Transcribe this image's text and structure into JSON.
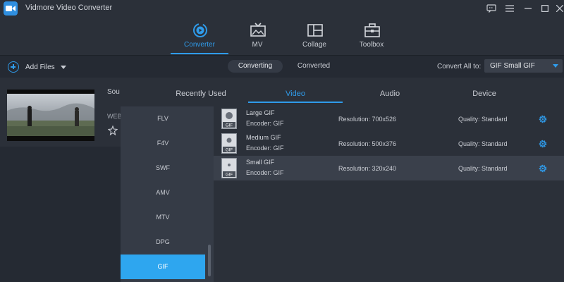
{
  "app": {
    "title": "Vidmore Video Converter"
  },
  "nav": [
    {
      "label": "Converter",
      "icon": "converter-icon",
      "active": true
    },
    {
      "label": "MV",
      "icon": "mv-icon"
    },
    {
      "label": "Collage",
      "icon": "collage-icon"
    },
    {
      "label": "Toolbox",
      "icon": "toolbox-icon"
    }
  ],
  "toolbar": {
    "add_files": "Add Files",
    "tabs": [
      "Converting",
      "Converted"
    ],
    "convert_all_label": "Convert All to:",
    "convert_all_value": "GIF Small GIF"
  },
  "file": {
    "source_prefix": "Sou",
    "format_prefix": "WEB"
  },
  "panel": {
    "tabs": [
      "Recently Used",
      "Video",
      "Audio",
      "Device"
    ],
    "active_tab": "Video",
    "formats": [
      "FLV",
      "F4V",
      "SWF",
      "AMV",
      "MTV",
      "DPG",
      "GIF"
    ],
    "active_format": "GIF",
    "options": [
      {
        "name": "Large GIF",
        "encoder": "Encoder: GIF",
        "resolution": "Resolution: 700x526",
        "quality": "Quality: Standard",
        "icon_label": "GIF"
      },
      {
        "name": "Medium GIF",
        "encoder": "Encoder: GIF",
        "resolution": "Resolution: 500x376",
        "quality": "Quality: Standard",
        "icon_label": "GIF"
      },
      {
        "name": "Small GIF",
        "encoder": "Encoder: GIF",
        "resolution": "Resolution: 320x240",
        "quality": "Quality: Standard",
        "icon_label": "GIF",
        "selected": true
      }
    ]
  },
  "colors": {
    "accent": "#2f9bea",
    "background": "#252a33",
    "panel": "#2b3039",
    "format_list": "#353b46",
    "selected_row": "#3a404b"
  }
}
